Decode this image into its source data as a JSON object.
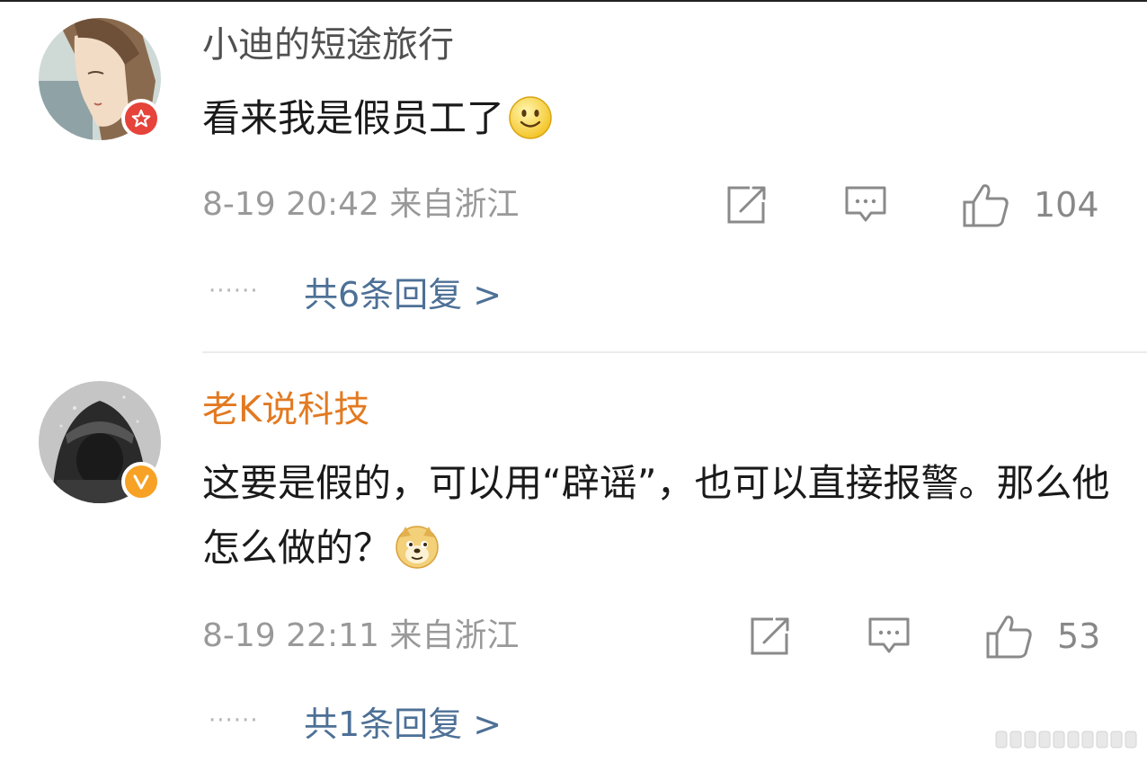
{
  "comments": [
    {
      "username": "小迪的短途旅行",
      "username_color": "#505050",
      "badge": "red-star-badge",
      "badge_color": "#e6433a",
      "text": "看来我是假员工了",
      "emoji": "smile-emoji",
      "timestamp": "8-19 20:42 来自浙江",
      "likes": "104",
      "replies_label": "共6条回复 >"
    },
    {
      "username": "老K说科技",
      "username_color": "#e27a22",
      "badge": "orange-v-badge",
      "badge_color": "#f7a125",
      "text": "这要是假的，可以用“辟谣”，也可以直接报警。那么他怎么做的？",
      "emoji": "doge-emoji",
      "timestamp": "8-19 22:11 来自浙江",
      "likes": "53",
      "replies_label": "共1条回复 >"
    }
  ],
  "reply_dots": "······",
  "icons": {
    "share": "share-icon",
    "comment": "comment-icon",
    "like": "thumbs-up-icon"
  },
  "colors": {
    "meta_gray": "#999999",
    "link_blue": "#4d7096",
    "icon_gray": "#8a8a8a"
  }
}
